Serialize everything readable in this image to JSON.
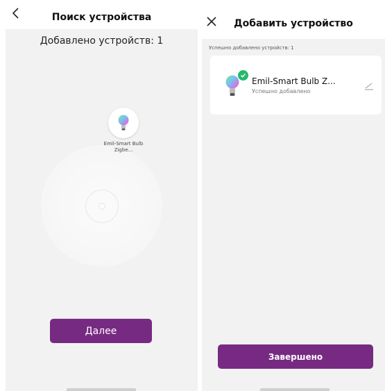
{
  "search_screen": {
    "title": "Поиск устройства",
    "added_count_text": "Добавлено устройств: 1",
    "found_device_label": "Emil-Smart Bulb Zigbe...",
    "next_button": "Далее",
    "icons": {
      "back": "chevron-left-icon",
      "device": "smart-bulb-icon"
    }
  },
  "add_screen": {
    "title": "Добавить устройство",
    "success_caption": "Успешно добавлено устройств: 1",
    "device": {
      "name": "Emil-Smart Bulb Z...",
      "status": "Успешно добавлено"
    },
    "finish_button": "Завершено",
    "icons": {
      "close": "close-icon",
      "check": "check-icon",
      "edit": "pencil-icon"
    }
  },
  "colors": {
    "accent": "#772a82",
    "success": "#26b86d",
    "background": "#f2f2f2"
  }
}
